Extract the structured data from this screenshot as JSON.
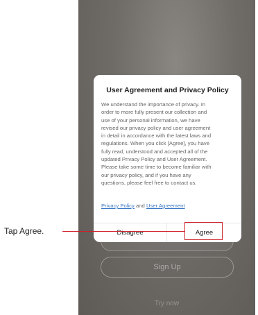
{
  "background": {
    "signup_label": "Sign Up",
    "trynow_label": "Try now"
  },
  "dialog": {
    "title": "User Agreement and Privacy Policy",
    "body_lines": [
      "We understand the importance of privacy. In",
      "order to more fully present our collection and",
      "use of your personal information, we have",
      "revised our privacy policy and user agreement",
      "in detail in accordance with the latest laws and",
      "regulations. When you click [Agree], you have",
      "fully read, understood and accepted all of the",
      "updated Privacy Policy and User Agreement.",
      "Please take some time to become familiar with",
      "our privacy policy, and if you have any",
      "questions, please feel free to contact us."
    ],
    "links": {
      "privacy_policy": "Privacy Policy",
      "connector": " and ",
      "user_agreement": "User Agreement"
    },
    "disagree_label": "Disagree",
    "agree_label": "Agree"
  },
  "annotation": {
    "label": "Tap Agree.",
    "color": "#d0202a"
  }
}
